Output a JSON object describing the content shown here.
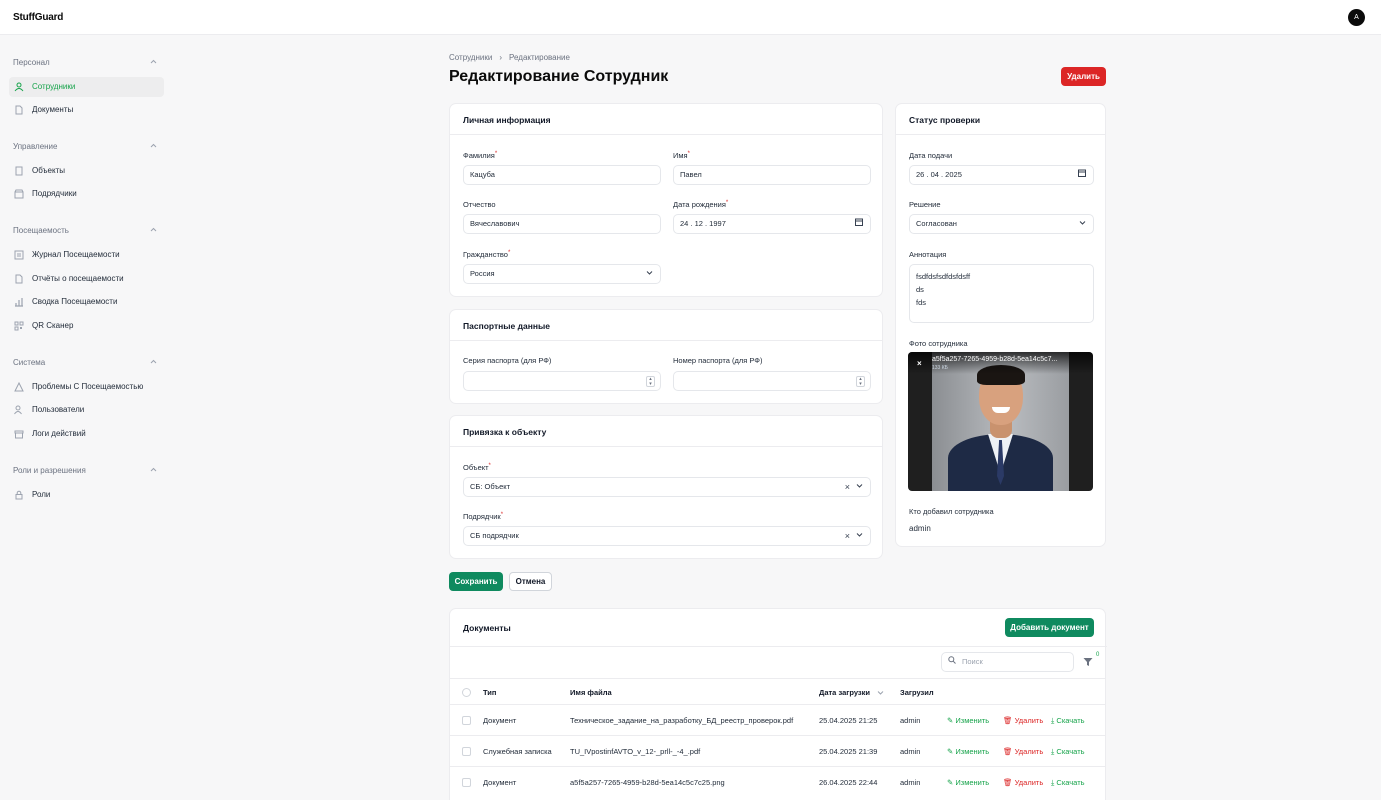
{
  "app": {
    "brand": "StuffGuard",
    "avatar_initial": "A"
  },
  "sidebar": {
    "sections": [
      {
        "title": "Персонал",
        "items": [
          {
            "label": "Сотрудники",
            "icon": "users-icon",
            "active": true
          },
          {
            "label": "Документы",
            "icon": "document-icon"
          }
        ]
      },
      {
        "title": "Управление",
        "items": [
          {
            "label": "Объекты",
            "icon": "building-icon"
          },
          {
            "label": "Подрядчики",
            "icon": "store-icon"
          }
        ]
      },
      {
        "title": "Посещаемость",
        "items": [
          {
            "label": "Журнал Посещаемости",
            "icon": "list-icon"
          },
          {
            "label": "Отчёты о посещаемости",
            "icon": "report-icon"
          },
          {
            "label": "Сводка Посещаемости",
            "icon": "bar-chart-icon"
          },
          {
            "label": "QR Сканер",
            "icon": "qr-icon"
          }
        ]
      },
      {
        "title": "Система",
        "items": [
          {
            "label": "Проблемы С Посещаемостью",
            "icon": "warning-icon"
          },
          {
            "label": "Пользователи",
            "icon": "users-icon"
          },
          {
            "label": "Логи действий",
            "icon": "archive-icon"
          }
        ]
      },
      {
        "title": "Роли и разрешения",
        "items": [
          {
            "label": "Роли",
            "icon": "lock-icon"
          }
        ]
      }
    ]
  },
  "breadcrumb": {
    "parent": "Сотрудники",
    "current": "Редактирование"
  },
  "page": {
    "title": "Редактирование Сотрудник",
    "delete_label": "Удалить"
  },
  "personal": {
    "title": "Личная информация",
    "last_name_label": "Фамилия",
    "last_name": "Кацуба",
    "first_name_label": "Имя",
    "first_name": "Павел",
    "patronymic_label": "Отчество",
    "patronymic": "Вячеславович",
    "birth_label": "Дата рождения",
    "birth": "24 . 12 . 1997",
    "citizenship_label": "Гражданство",
    "citizenship": "Россия"
  },
  "passport": {
    "title": "Паспортные данные",
    "series_label": "Серия паспорта (для РФ)",
    "series": "",
    "number_label": "Номер паспорта (для РФ)",
    "number": ""
  },
  "binding": {
    "title": "Привязка к объекту",
    "object_label": "Объект",
    "object": "СБ: Объект",
    "contractor_label": "Подрядчик",
    "contractor": "СБ подрядчик"
  },
  "actions": {
    "save": "Сохранить",
    "cancel": "Отмена"
  },
  "status": {
    "title": "Статус проверки",
    "date_label": "Дата подачи",
    "date": "26 . 04 . 2025",
    "decision_label": "Решение",
    "decision": "Согласован",
    "annotation_label": "Аннотация",
    "annotation_lines": [
      "fsdfdsfsdfdsfdsff",
      "ds",
      "fds"
    ],
    "photo_label": "Фото сотрудника",
    "photo_file": "a5f5a257-7265-4959-b28d-5ea14c5c7...",
    "photo_size": "133 КБ",
    "added_by_label": "Кто добавил сотрудника",
    "added_by": "admin"
  },
  "documents": {
    "title": "Документы",
    "add_label": "Добавить документ",
    "search_placeholder": "Поиск",
    "filter_count": "0",
    "columns": {
      "type": "Тип",
      "file": "Имя файла",
      "date": "Дата загрузки",
      "by": "Загрузил"
    },
    "row_actions": {
      "edit": "Изменить",
      "delete": "Удалить",
      "download": "Скачать"
    },
    "rows": [
      {
        "type": "Документ",
        "file": "Техническое_задание_на_разработку_БД_реестр_проверок.pdf",
        "date": "25.04.2025 21:25",
        "by": "admin"
      },
      {
        "type": "Служебная записка",
        "file": "TU_IVpostinfAVTO_v_12-_prll-_-4_.pdf",
        "date": "25.04.2025 21:39",
        "by": "admin"
      },
      {
        "type": "Документ",
        "file": "a5f5a257-7265-4959-b28d-5ea14c5c7c25.png",
        "date": "26.04.2025 22:44",
        "by": "admin"
      }
    ]
  },
  "colors": {
    "accent": "#0f8a5f",
    "danger": "#dc2626",
    "active_nav": "#16a34a"
  }
}
